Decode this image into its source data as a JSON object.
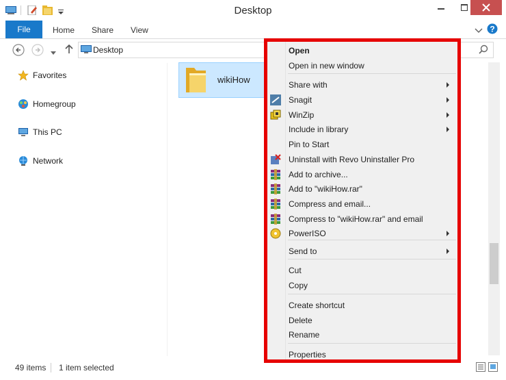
{
  "window": {
    "title": "Desktop"
  },
  "ribbon": {
    "tabs": [
      "File",
      "Home",
      "Share",
      "View"
    ]
  },
  "address": {
    "path": "Desktop"
  },
  "nav_pane": {
    "items": [
      "Favorites",
      "Homegroup",
      "This PC",
      "Network"
    ]
  },
  "file": {
    "name": "wikiHow"
  },
  "status": {
    "count": "49 items",
    "selection": "1 item selected"
  },
  "context_menu": {
    "items": [
      {
        "label": "Open",
        "bold": true
      },
      {
        "label": "Open in new window"
      },
      {
        "label": "Share with",
        "submenu": true
      },
      {
        "label": "Snagit",
        "submenu": true,
        "icon": "snagit-icon"
      },
      {
        "label": "WinZip",
        "submenu": true,
        "icon": "winzip-icon"
      },
      {
        "label": "Include in library",
        "submenu": true
      },
      {
        "label": "Pin to Start"
      },
      {
        "label": "Uninstall with Revo Uninstaller Pro",
        "icon": "revo-icon"
      },
      {
        "label": "Add to archive...",
        "icon": "winrar-icon"
      },
      {
        "label": "Add to \"wikiHow.rar\"",
        "icon": "winrar-icon"
      },
      {
        "label": "Compress and email...",
        "icon": "winrar-icon"
      },
      {
        "label": "Compress to \"wikiHow.rar\" and email",
        "icon": "winrar-icon"
      },
      {
        "label": "PowerISO",
        "submenu": true,
        "icon": "poweriso-icon"
      },
      {
        "label": "Send to",
        "submenu": true
      },
      {
        "label": "Cut"
      },
      {
        "label": "Copy"
      },
      {
        "label": "Create shortcut"
      },
      {
        "label": "Delete"
      },
      {
        "label": "Rename"
      },
      {
        "label": "Properties"
      }
    ]
  },
  "colors": {
    "file_tab": "#1979ca",
    "close_button": "#c75050",
    "highlight": "#e60000",
    "selection": "#cce8ff"
  }
}
